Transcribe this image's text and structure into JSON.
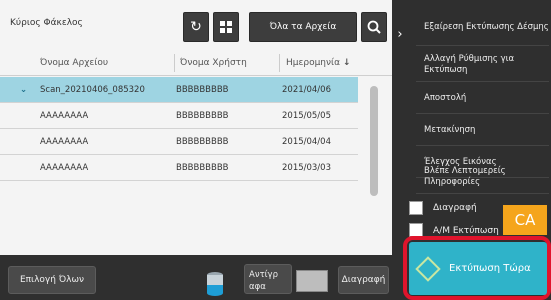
{
  "folder_title": "Κύριος Φάκελος",
  "toolbar": {
    "all_files_label": "Όλα τα Αρχεία"
  },
  "table": {
    "headers": [
      "Όνομα Αρχείου",
      "Όνομα Χρήστη",
      "Ημερομηνία"
    ],
    "rows": [
      {
        "file": "Scan_20210406_085320",
        "user": "BBBBBBBBB",
        "date": "2021/04/06",
        "selected": true
      },
      {
        "file": "AAAAAAAA",
        "user": "BBBBBBBBB",
        "date": "2015/05/05",
        "selected": false
      },
      {
        "file": "AAAAAAAA",
        "user": "BBBBBBBBB",
        "date": "2015/04/04",
        "selected": false
      },
      {
        "file": "AAAAAAAA",
        "user": "BBBBBBBBB",
        "date": "2015/03/03",
        "selected": false
      }
    ]
  },
  "bottom": {
    "select_all": "Επιλογή Όλων",
    "copies_label": "Αντίγρ αφα",
    "delete": "Διαγραφή"
  },
  "side_menu": {
    "items": [
      "Εξαίρεση Εκτύπωσης Δέσμης",
      "Αλλαγή Ρύθμισης για Εκτύπωση",
      "Αποστολή",
      "Μετακίνηση",
      "Έλεγχος Εικόνας",
      "Βλέπε Λεπτομερείς Πληροφορίες"
    ],
    "checkbox_delete": "Διαγραφή",
    "checkbox_bw": "Α/Μ Εκτύπωση",
    "ca": "CA",
    "print_now": "Εκτύπωση Τώρα"
  },
  "colors": {
    "selected_row": "#9ed4e2",
    "print_now": "#2fb3c9",
    "ca": "#f5a51c",
    "highlight_frame": "#e0142c"
  }
}
